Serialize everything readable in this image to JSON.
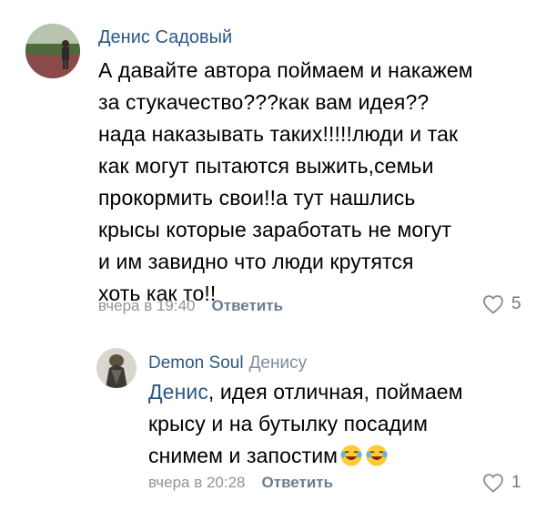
{
  "comment1": {
    "author": "Денис Садовый",
    "text_lines": [
      "А давайте автора поймаем и накажем",
      "за стукачество???как вам идея??",
      "нада наказывать таких!!!!!люди и так",
      "как могут пытаются выжить,семьи",
      "прокормить свои!!а тут нашлись",
      "крысы которые заработать не могут",
      "и им завидно что люди крутятся",
      "хоть как то!!"
    ],
    "time": "вчера в 19:40",
    "reply_label": "Ответить",
    "likes": "5"
  },
  "comment2": {
    "author": "Demon Soul",
    "reply_to": "Денису",
    "mention": "Денис",
    "text_line1_rest": ", идея отличная, поймаем",
    "text_line2": "крысу и на бутылку посадим",
    "text_line3": "снимем и запостим",
    "emoji_name": "laughing-tears-emoji",
    "time": "вчера в 20:28",
    "reply_label": "Ответить",
    "likes": "1"
  },
  "colors": {
    "link": "#2a5885",
    "meta": "#939393",
    "reply": "#6a7c90"
  }
}
